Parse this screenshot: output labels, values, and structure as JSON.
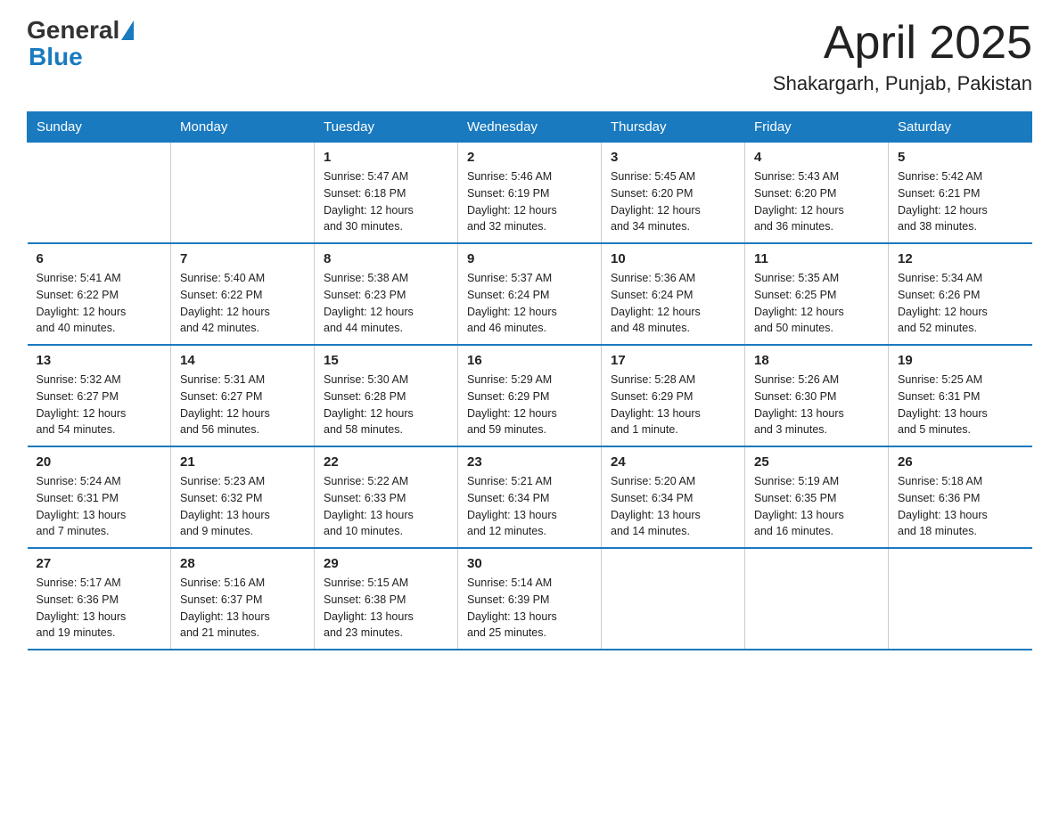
{
  "header": {
    "logo_general": "General",
    "logo_blue": "Blue",
    "month": "April 2025",
    "location": "Shakargarh, Punjab, Pakistan"
  },
  "days_of_week": [
    "Sunday",
    "Monday",
    "Tuesday",
    "Wednesday",
    "Thursday",
    "Friday",
    "Saturday"
  ],
  "weeks": [
    [
      {
        "day": "",
        "info": ""
      },
      {
        "day": "",
        "info": ""
      },
      {
        "day": "1",
        "info": "Sunrise: 5:47 AM\nSunset: 6:18 PM\nDaylight: 12 hours\nand 30 minutes."
      },
      {
        "day": "2",
        "info": "Sunrise: 5:46 AM\nSunset: 6:19 PM\nDaylight: 12 hours\nand 32 minutes."
      },
      {
        "day": "3",
        "info": "Sunrise: 5:45 AM\nSunset: 6:20 PM\nDaylight: 12 hours\nand 34 minutes."
      },
      {
        "day": "4",
        "info": "Sunrise: 5:43 AM\nSunset: 6:20 PM\nDaylight: 12 hours\nand 36 minutes."
      },
      {
        "day": "5",
        "info": "Sunrise: 5:42 AM\nSunset: 6:21 PM\nDaylight: 12 hours\nand 38 minutes."
      }
    ],
    [
      {
        "day": "6",
        "info": "Sunrise: 5:41 AM\nSunset: 6:22 PM\nDaylight: 12 hours\nand 40 minutes."
      },
      {
        "day": "7",
        "info": "Sunrise: 5:40 AM\nSunset: 6:22 PM\nDaylight: 12 hours\nand 42 minutes."
      },
      {
        "day": "8",
        "info": "Sunrise: 5:38 AM\nSunset: 6:23 PM\nDaylight: 12 hours\nand 44 minutes."
      },
      {
        "day": "9",
        "info": "Sunrise: 5:37 AM\nSunset: 6:24 PM\nDaylight: 12 hours\nand 46 minutes."
      },
      {
        "day": "10",
        "info": "Sunrise: 5:36 AM\nSunset: 6:24 PM\nDaylight: 12 hours\nand 48 minutes."
      },
      {
        "day": "11",
        "info": "Sunrise: 5:35 AM\nSunset: 6:25 PM\nDaylight: 12 hours\nand 50 minutes."
      },
      {
        "day": "12",
        "info": "Sunrise: 5:34 AM\nSunset: 6:26 PM\nDaylight: 12 hours\nand 52 minutes."
      }
    ],
    [
      {
        "day": "13",
        "info": "Sunrise: 5:32 AM\nSunset: 6:27 PM\nDaylight: 12 hours\nand 54 minutes."
      },
      {
        "day": "14",
        "info": "Sunrise: 5:31 AM\nSunset: 6:27 PM\nDaylight: 12 hours\nand 56 minutes."
      },
      {
        "day": "15",
        "info": "Sunrise: 5:30 AM\nSunset: 6:28 PM\nDaylight: 12 hours\nand 58 minutes."
      },
      {
        "day": "16",
        "info": "Sunrise: 5:29 AM\nSunset: 6:29 PM\nDaylight: 12 hours\nand 59 minutes."
      },
      {
        "day": "17",
        "info": "Sunrise: 5:28 AM\nSunset: 6:29 PM\nDaylight: 13 hours\nand 1 minute."
      },
      {
        "day": "18",
        "info": "Sunrise: 5:26 AM\nSunset: 6:30 PM\nDaylight: 13 hours\nand 3 minutes."
      },
      {
        "day": "19",
        "info": "Sunrise: 5:25 AM\nSunset: 6:31 PM\nDaylight: 13 hours\nand 5 minutes."
      }
    ],
    [
      {
        "day": "20",
        "info": "Sunrise: 5:24 AM\nSunset: 6:31 PM\nDaylight: 13 hours\nand 7 minutes."
      },
      {
        "day": "21",
        "info": "Sunrise: 5:23 AM\nSunset: 6:32 PM\nDaylight: 13 hours\nand 9 minutes."
      },
      {
        "day": "22",
        "info": "Sunrise: 5:22 AM\nSunset: 6:33 PM\nDaylight: 13 hours\nand 10 minutes."
      },
      {
        "day": "23",
        "info": "Sunrise: 5:21 AM\nSunset: 6:34 PM\nDaylight: 13 hours\nand 12 minutes."
      },
      {
        "day": "24",
        "info": "Sunrise: 5:20 AM\nSunset: 6:34 PM\nDaylight: 13 hours\nand 14 minutes."
      },
      {
        "day": "25",
        "info": "Sunrise: 5:19 AM\nSunset: 6:35 PM\nDaylight: 13 hours\nand 16 minutes."
      },
      {
        "day": "26",
        "info": "Sunrise: 5:18 AM\nSunset: 6:36 PM\nDaylight: 13 hours\nand 18 minutes."
      }
    ],
    [
      {
        "day": "27",
        "info": "Sunrise: 5:17 AM\nSunset: 6:36 PM\nDaylight: 13 hours\nand 19 minutes."
      },
      {
        "day": "28",
        "info": "Sunrise: 5:16 AM\nSunset: 6:37 PM\nDaylight: 13 hours\nand 21 minutes."
      },
      {
        "day": "29",
        "info": "Sunrise: 5:15 AM\nSunset: 6:38 PM\nDaylight: 13 hours\nand 23 minutes."
      },
      {
        "day": "30",
        "info": "Sunrise: 5:14 AM\nSunset: 6:39 PM\nDaylight: 13 hours\nand 25 minutes."
      },
      {
        "day": "",
        "info": ""
      },
      {
        "day": "",
        "info": ""
      },
      {
        "day": "",
        "info": ""
      }
    ]
  ]
}
